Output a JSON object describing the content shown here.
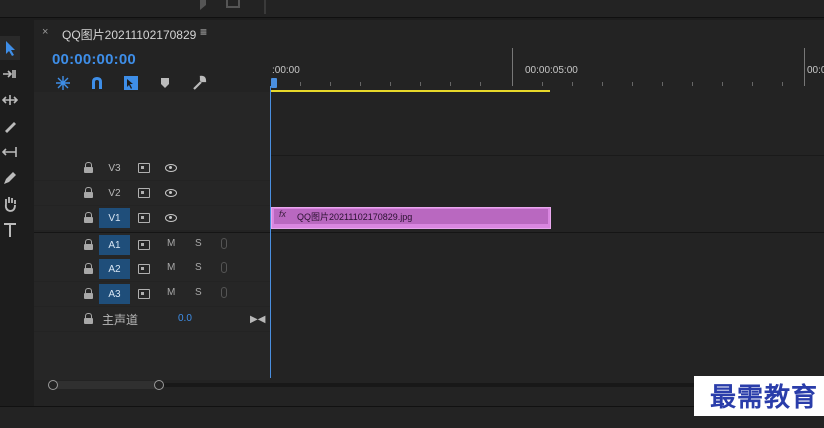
{
  "sequence": {
    "tab_close": "×",
    "title": "QQ图片20211102170829",
    "menu": "≡",
    "timecode": "00:00:00:00"
  },
  "ruler": {
    "labels": [
      ":00:00",
      "00:00:05:00",
      "00:0"
    ]
  },
  "tracks": {
    "video": [
      {
        "name": "V3"
      },
      {
        "name": "V2"
      },
      {
        "name": "V1"
      }
    ],
    "audio": [
      {
        "name": "A1",
        "m": "M",
        "s": "S"
      },
      {
        "name": "A2",
        "m": "M",
        "s": "S"
      },
      {
        "name": "A3",
        "m": "M",
        "s": "S"
      }
    ],
    "master": {
      "name": "主声道",
      "value": "0.0"
    }
  },
  "clip": {
    "fx": "fx",
    "name": "QQ图片20211102170829.jpg",
    "color": "#d986e0"
  },
  "colors": {
    "accent": "#3e8ee8",
    "workarea": "#e8d82a",
    "playhead": "#4a8fe0"
  },
  "watermark": {
    "text": "最需教育"
  }
}
